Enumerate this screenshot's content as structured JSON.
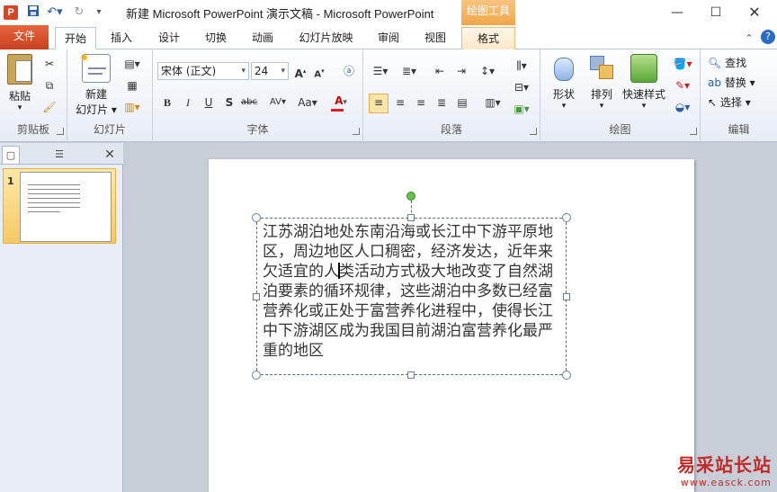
{
  "window": {
    "title": "新建 Microsoft PowerPoint 演示文稿 - Microsoft PowerPoint",
    "app_logo": "P",
    "contextual_tool": "绘图工具"
  },
  "tabs": [
    {
      "label": "文件"
    },
    {
      "label": "开始"
    },
    {
      "label": "插入"
    },
    {
      "label": "设计"
    },
    {
      "label": "切换"
    },
    {
      "label": "动画"
    },
    {
      "label": "幻灯片放映"
    },
    {
      "label": "审阅"
    },
    {
      "label": "视图"
    },
    {
      "label": "格式"
    }
  ],
  "ribbon": {
    "clipboard": {
      "group_label": "剪贴板",
      "paste": "粘贴"
    },
    "slides": {
      "group_label": "幻灯片",
      "new_slide": "新建",
      "new_slide_2": "幻灯片 ▾"
    },
    "font": {
      "group_label": "字体",
      "font_name": "宋体 (正文)",
      "font_size": "24"
    },
    "paragraph": {
      "group_label": "段落"
    },
    "drawing": {
      "group_label": "绘图",
      "shape": "形状",
      "arrange": "排列",
      "quick_style": "快速样式"
    },
    "editing": {
      "group_label": "编辑",
      "find": "查找",
      "replace": "替换",
      "select": "选择"
    }
  },
  "thumbnails": {
    "slide_number": "1"
  },
  "slide": {
    "text_before_caret": "江苏湖泊地处东南沿海或长江中下游平原地区，周边地区人口稠密，经济发达，近年来欠适宜的人",
    "text_after_caret": "类活动方式极大地改变了自然湖泊要素的循环规律，这些湖泊中多数已经富营养化或正处于富营养化进程中，使得长江中下游湖区成为我国目前湖泊富营养化最严重的地区"
  },
  "watermark": {
    "main": "易采站长站",
    "url": "www.easck.com"
  },
  "colors": {
    "file_tab": "#d5532b",
    "contextual_tab": "#f0a64a",
    "rotation_handle": "#62c24a"
  }
}
